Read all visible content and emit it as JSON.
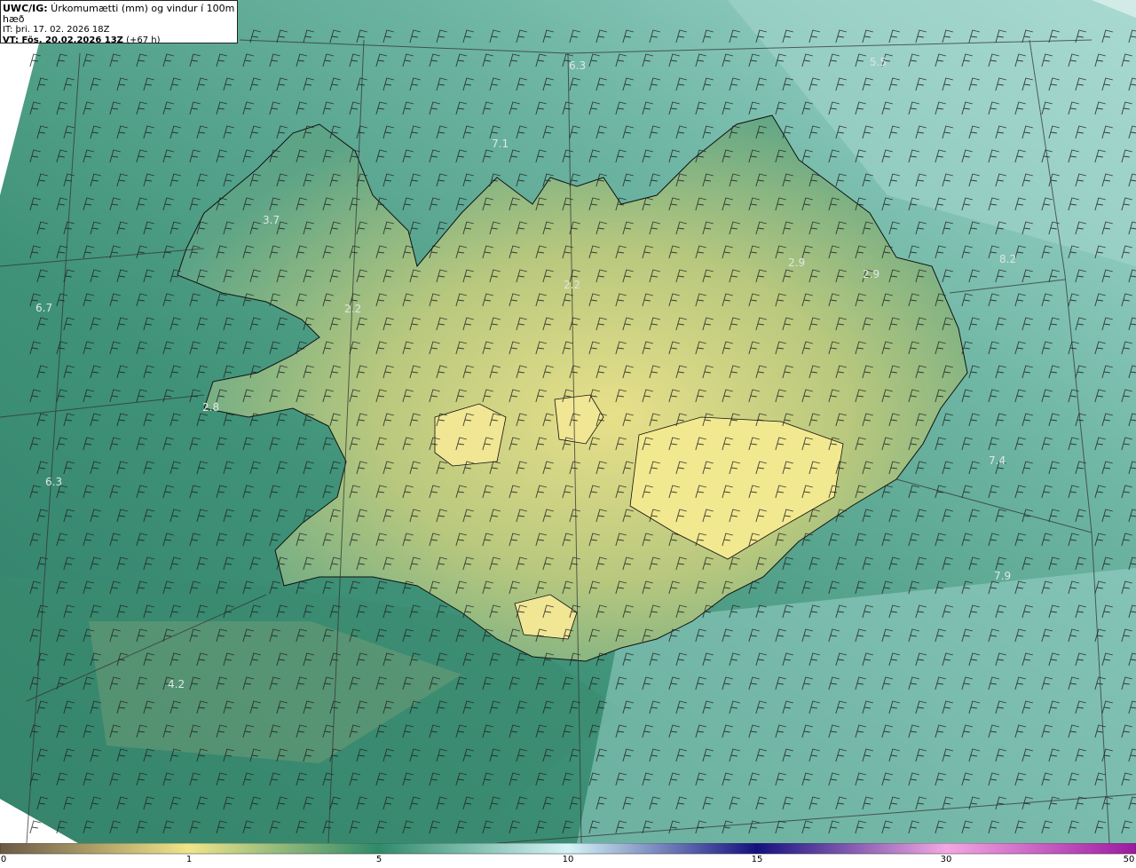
{
  "header": {
    "code": "UWC/IG:",
    "title": " Úrkomumætti (mm) og vindur í 100m hæð",
    "it_line": "IT: þri. 17. 02. 2026 18Z",
    "vt_bold": "VT: Fös. 20.02.2026 13Z",
    "vt_suffix": " (+67 h)"
  },
  "map_labels": [
    {
      "text": "6.3",
      "id": "label-1"
    },
    {
      "text": "5.5",
      "id": "label-2"
    },
    {
      "text": "7.1",
      "id": "label-3"
    },
    {
      "text": "3.7",
      "id": "label-4"
    },
    {
      "text": "2.9",
      "id": "label-5"
    },
    {
      "text": "2.9",
      "id": "label-6"
    },
    {
      "text": "8.2",
      "id": "label-7"
    },
    {
      "text": "6.7",
      "id": "label-8"
    },
    {
      "text": "2.2",
      "id": "label-9"
    },
    {
      "text": "2.2",
      "id": "label-10"
    },
    {
      "text": "2.8",
      "id": "label-11"
    },
    {
      "text": "6.3",
      "id": "label-12"
    },
    {
      "text": "7.4",
      "id": "label-13"
    },
    {
      "text": "7.9",
      "id": "label-14"
    },
    {
      "text": "4.2",
      "id": "label-15"
    }
  ],
  "colorbar": {
    "ticks": [
      "0",
      "1",
      "5",
      "10",
      "15",
      "30",
      "50"
    ],
    "stops": [
      "#6b5a45",
      "#f0e58a",
      "#2f8a6a",
      "#d6f4f6",
      "#14117f",
      "#f4a7e1",
      "#9b1aa0"
    ]
  },
  "colors": {
    "sea_dark": "#2d7a6a",
    "sea_mid": "#5aa892",
    "land_yellow": "#d8d680",
    "ice_light": "#b8e2dc"
  }
}
